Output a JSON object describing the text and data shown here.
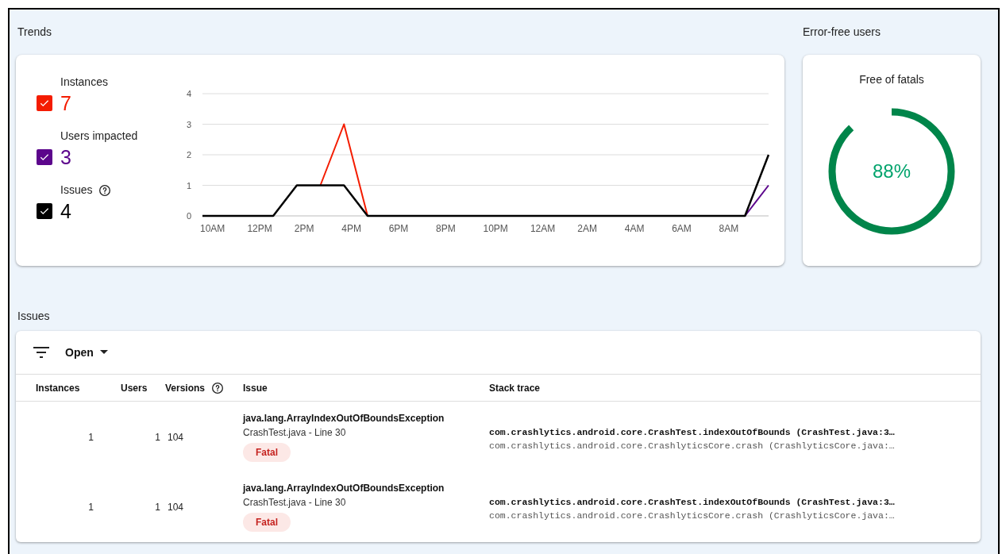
{
  "trends": {
    "title": "Trends",
    "metrics": [
      {
        "value": "7",
        "checked": true
      },
      {
        "value": "3",
        "checked": true
      },
      {
        "value": "4",
        "checked": true,
        "help": true
      }
    ],
    "chart_data": {
      "type": "line",
      "x": [
        "10AM",
        null,
        "12PM",
        null,
        "2PM",
        null,
        "4PM",
        null,
        "6PM",
        null,
        "8PM",
        null,
        "10PM",
        null,
        "12AM",
        null,
        "2AM",
        null,
        "4AM",
        null,
        "6AM",
        null,
        "8AM",
        null,
        null
      ],
      "yticks": [
        0,
        1,
        2,
        3,
        4
      ],
      "ylim": [
        0,
        4
      ],
      "grid": true,
      "series": [
        {
          "name": "Instances",
          "color": "#f41c00",
          "values": [
            null,
            null,
            null,
            null,
            null,
            1,
            3,
            0,
            null,
            null,
            null,
            null,
            null,
            null,
            null,
            null,
            null,
            null,
            null,
            null,
            null,
            null,
            null,
            null,
            null
          ]
        },
        {
          "name": "Users impacted",
          "color": "#5c068c",
          "values": [
            null,
            null,
            null,
            null,
            null,
            null,
            null,
            null,
            null,
            null,
            null,
            null,
            null,
            null,
            null,
            null,
            null,
            null,
            null,
            null,
            null,
            null,
            null,
            0,
            1
          ]
        },
        {
          "name": "Issues",
          "color": "#000000",
          "values": [
            0,
            0,
            0,
            0,
            1,
            1,
            1,
            0,
            0,
            0,
            0,
            0,
            0,
            0,
            0,
            0,
            0,
            0,
            0,
            0,
            0,
            0,
            0,
            0,
            2
          ]
        }
      ]
    }
  },
  "error_free": {
    "title": "Error-free users",
    "card_title": "Free of fatals",
    "reading": "88%"
  },
  "issues": {
    "title": "Issues",
    "filter": "Open",
    "columns": [
      {
        "label": "Instances"
      },
      {
        "label": "Users"
      },
      {
        "label": "Versions",
        "help": true
      },
      {
        "label": "Issue"
      },
      {
        "label": "Stack trace"
      }
    ],
    "rows": [
      {
        "instances": "1",
        "users": "1",
        "versions": "104",
        "exception": "java.lang.ArrayIndexOutOfBoundsException",
        "location": "CrashTest.java - Line 30",
        "badge": "Fatal",
        "trace": [
          "com.crashlytics.android.core.CrashTest.indexOutOfBounds (CrashTest.java:3…",
          "com.crashlytics.android.core.CrashlyticsCore.crash (CrashlyticsCore.java:…"
        ]
      },
      {
        "instances": "1",
        "users": "1",
        "versions": "104",
        "exception": "java.lang.ArrayIndexOutOfBoundsException",
        "location": "CrashTest.java - Line 30",
        "badge": "Fatal",
        "trace": [
          "com.crashlytics.android.core.CrashTest.indexOutOfBounds (CrashTest.java:3…",
          "com.crashlytics.android.core.CrashlyticsCore.crash (CrashlyticsCore.java:…"
        ]
      }
    ]
  }
}
